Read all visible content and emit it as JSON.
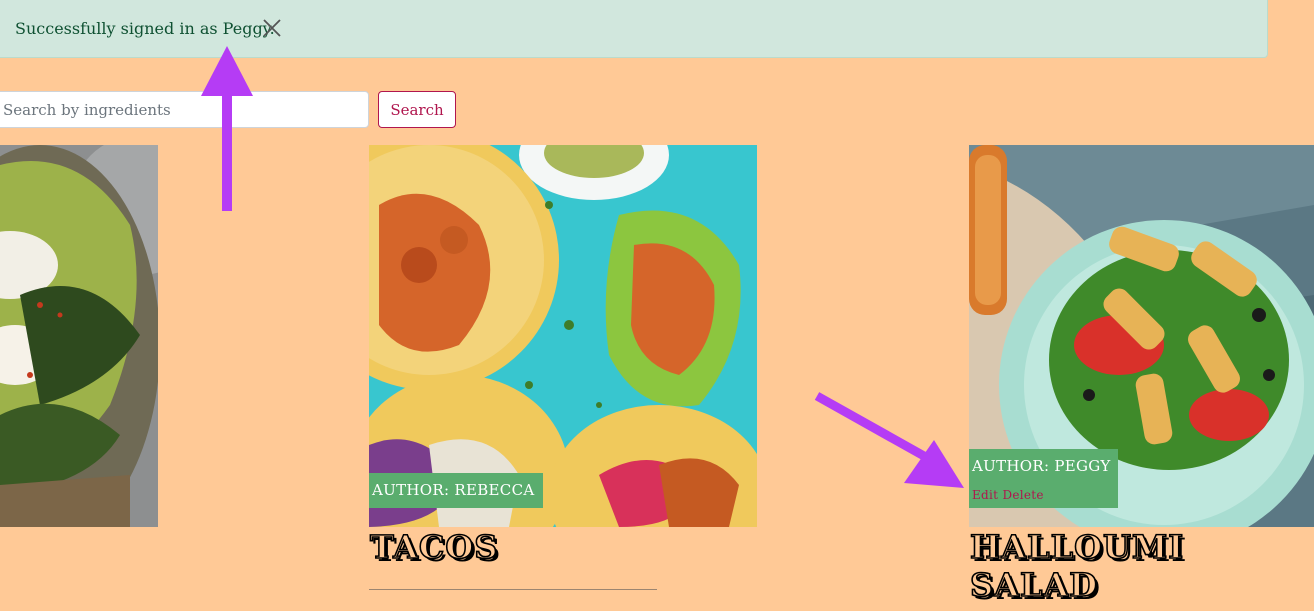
{
  "alert": {
    "message": "Successfully signed in as Peggy.",
    "close_icon": "close-icon",
    "colors": {
      "background": "#d1e7dd",
      "text": "#0f5132"
    }
  },
  "search": {
    "placeholder": "Search by ingredients",
    "button_label": "Search"
  },
  "recipes": [
    {
      "image": "avocado-toast-photo"
    },
    {
      "image": "tacos-photo",
      "author": "AUTHOR: REBECCA",
      "title": "TACOS"
    },
    {
      "image": "halloumi-salad-photo",
      "author": "AUTHOR: PEGGY",
      "title_line1": "HALLOUMI",
      "title_line2": "SALAD",
      "edit_label": "Edit",
      "delete_label": "Delete"
    }
  ],
  "colors": {
    "page_background": "#ffc996",
    "badge": "#5aad6e",
    "accent": "#b0164e",
    "annotation_arrow": "#b53cf5"
  }
}
